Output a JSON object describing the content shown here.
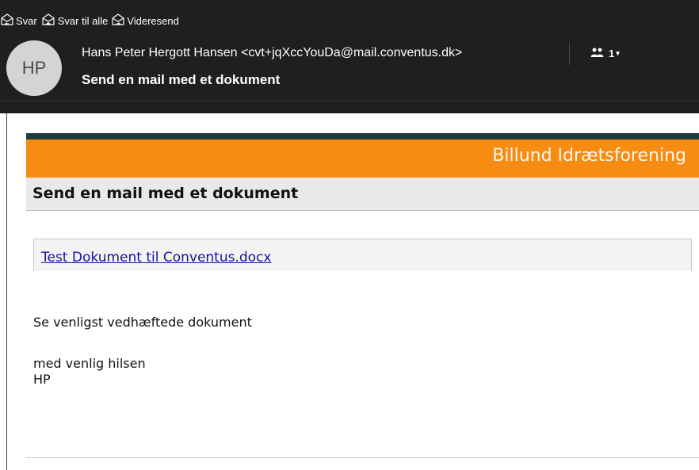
{
  "toolbar": {
    "reply_label": "Svar",
    "reply_all_label": "Svar til alle",
    "forward_label": "Videresend"
  },
  "message": {
    "avatar_initials": "HP",
    "sender": "Hans Peter Hergott Hansen <cvt+jqXccYouDa@mail.conventus.dk>",
    "recipient_count": "1",
    "subject": "Send en mail med et dokument"
  },
  "email_body": {
    "organization": "Billund Idrætsforening",
    "title": "Send en mail med et dokument",
    "attachment_link": "Test Dokument til Conventus.docx",
    "paragraph": "Se venligst vedhæftede dokument",
    "closing": "med venlig hilsen",
    "signature": "HP"
  },
  "colors": {
    "header_bg": "#1f1f1f",
    "banner_orange": "#f78c12",
    "top_stripe": "#1d3d3a",
    "title_bar_bg": "#e9e9e9",
    "link": "#1a0dab"
  },
  "icons": [
    "reply-icon",
    "reply-all-icon",
    "forward-icon",
    "people-icon",
    "chevron-down-icon"
  ]
}
